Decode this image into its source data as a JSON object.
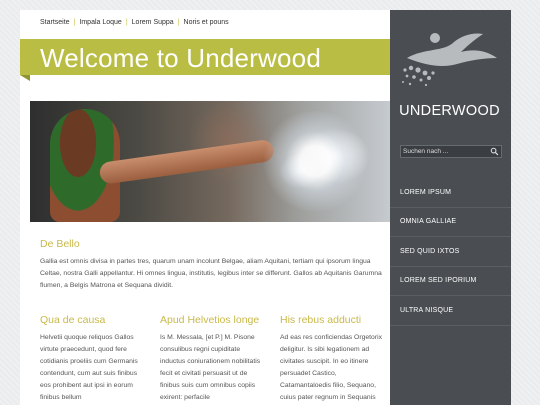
{
  "topnav": {
    "items": [
      "Startseite",
      "Impala Loque",
      "Lorem Suppa",
      "Noris et pouns"
    ]
  },
  "banner": {
    "title": "Welcome to Underwood"
  },
  "intro": {
    "heading": "De Bello",
    "text": "Gallia est omnis divisa in partes tres, quarum unam incolunt Belgae, aliam Aquitani, tertiam qui ipsorum lingua Celtae, nostra Galli appellantur. Hi omnes lingua, institutis, legibus inter se differunt. Gallos ab Aquitanis Garumna flumen, a Belgis Matrona et Sequana dividit."
  },
  "columns": [
    {
      "heading": "Qua de causa",
      "text": "Helvetii quoque reliquos Gallos virtute praecedunt, quod fere cotidianis proeliis cum Germanis contendunt, cum aut suis finibus eos prohibent aut ipsi in eorum finibus bellum"
    },
    {
      "heading": "Apud Helvetios longe",
      "text": "Is M. Messala, [et P.] M. Pisone consulibus regni cupiditate inductus coniurationem nobilitatis fecit et civitati persuasit ut de finibus suis cum omnibus copiis exirent: perfacile"
    },
    {
      "heading": "His rebus adducti",
      "text": "Ad eas res conficiendas Orgetorix deligitur. Is sibi legationem ad civitates suscipit. In eo itinere persuadet Castico, Catamantaloedis filio, Sequano, cuius pater regnum in Sequanis"
    }
  ],
  "sidebar": {
    "site_name": "UNDERWOOD",
    "search_placeholder": "Suchen nach ...",
    "menu": [
      "LOREM IPSUM",
      "OMNIA GALLIAE",
      "SED QUID IXTOS",
      "LOREM SED IPORIUM",
      "ULTRA NISQUE"
    ]
  },
  "colors": {
    "accent": "#b9bd44",
    "heading": "#c9b94a",
    "sidebar": "#4a4e52"
  },
  "icons": {
    "search": "magnifier-icon",
    "logo": "swimmer-logo-icon"
  }
}
